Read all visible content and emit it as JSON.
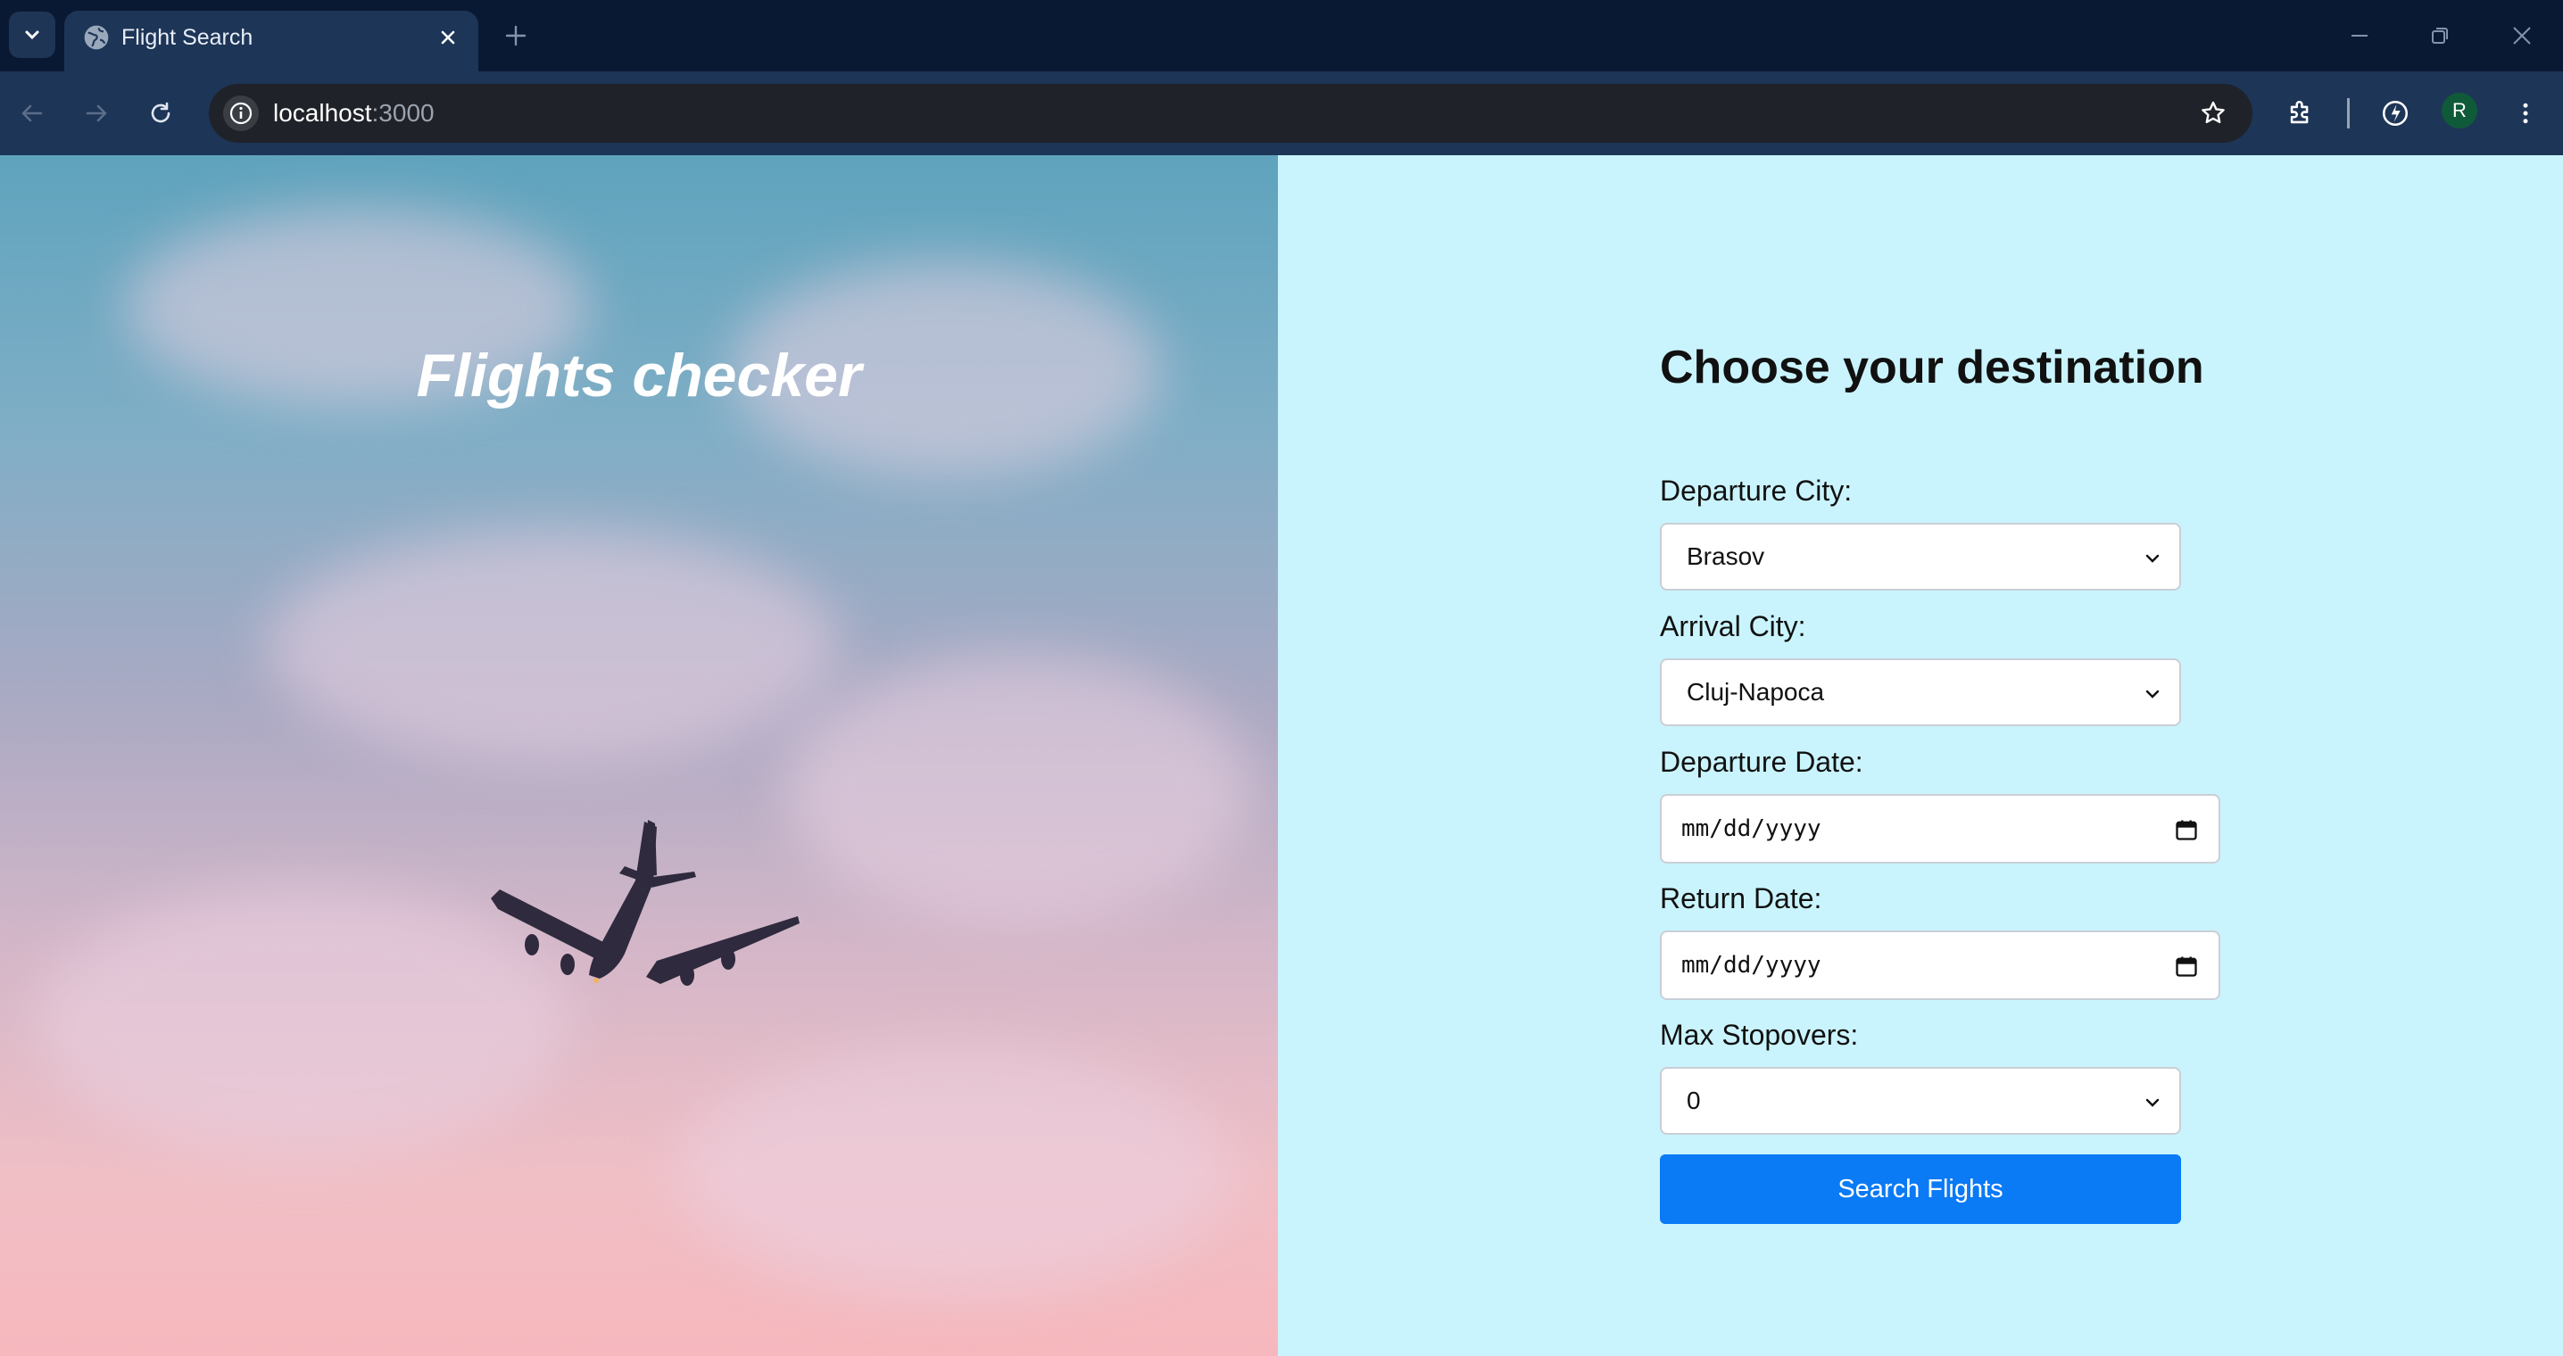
{
  "browser": {
    "tab_title": "Flight Search",
    "url_host": "localhost",
    "url_port": ":3000",
    "profile_initial": "R"
  },
  "hero": {
    "title": "Flights checker"
  },
  "form": {
    "heading": "Choose your destination",
    "departure_city_label": "Departure City:",
    "departure_city_value": "Brasov",
    "arrival_city_label": "Arrival City:",
    "arrival_city_value": "Cluj-Napoca",
    "departure_date_label": "Departure Date:",
    "departure_date_placeholder": "mm/dd/yyyy",
    "return_date_label": "Return Date:",
    "return_date_placeholder": "mm/dd/yyyy",
    "max_stopovers_label": "Max Stopovers:",
    "max_stopovers_value": "0",
    "submit_label": "Search Flights"
  },
  "colors": {
    "panel_background": "#caf4fd",
    "button": "#0a7af5",
    "browser_frame": "#1d3557"
  }
}
